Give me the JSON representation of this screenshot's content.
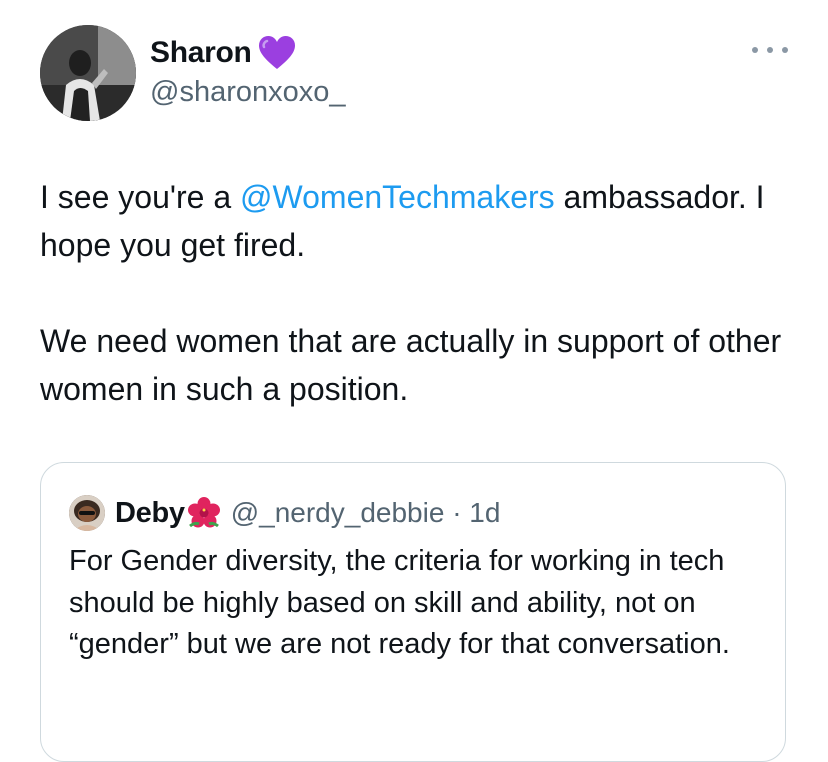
{
  "author": {
    "display_name": "Sharon",
    "handle": "@sharonxoxo_",
    "badge_icon": "purple-heart-icon",
    "badge_color": "#9b3fe0"
  },
  "tweet": {
    "line1_prefix": "I see you're a ",
    "mention": "@WomenTechmakers",
    "line1_suffix": " ambassador. I hope you get fired.",
    "paragraph2": "We need women that are actually in support of other women in such a position."
  },
  "quoted_tweet": {
    "display_name": "Deby",
    "badge_icon": "hibiscus-icon",
    "handle_meta": "@_nerdy_debbie · 1d",
    "text": "For Gender diversity, the criteria for working in tech should be highly based on skill and ability, not on “gender” but we are not ready for that conversation."
  },
  "icons": {
    "more": "more-options-icon"
  },
  "colors": {
    "text": "#0f1419",
    "secondary": "#536471",
    "link": "#1d9bf0",
    "border": "#cfd9de"
  }
}
